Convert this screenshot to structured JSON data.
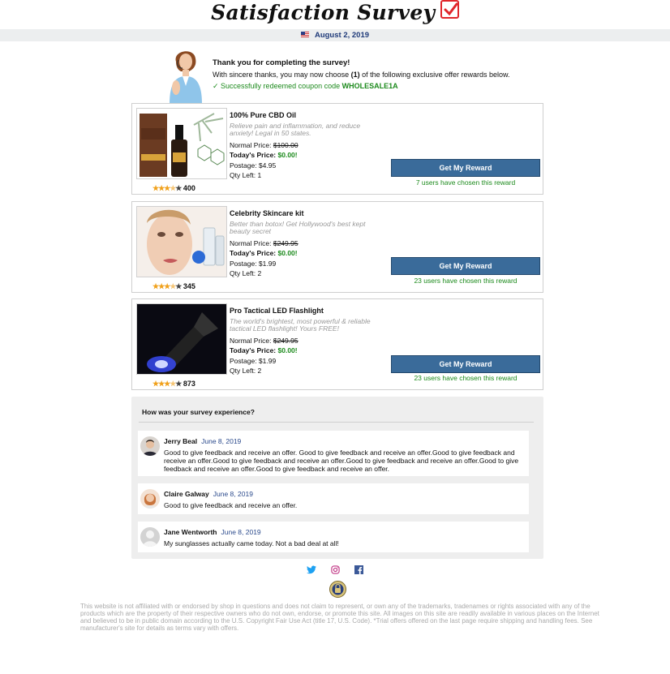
{
  "header": {
    "title": "Satisfaction Survey"
  },
  "datebar": {
    "date": "August 2, 2019"
  },
  "intro": {
    "heading": "Thank you for completing the survey!",
    "line2_pre": "With sincere thanks, you may now choose ",
    "line2_bold": "(1)",
    "line2_post": " of the following exclusive offer rewards below.",
    "coupon_pre": "✓ Successfully redeemed coupon code ",
    "coupon_code": "WHOLESALE1A"
  },
  "offers": [
    {
      "name": "100% Pure CBD Oil",
      "description": "Relieve pain and inflammation, and reduce anxiety! Legal in 50 states.",
      "normal_label": "Normal Price: ",
      "normal_price": "$100.00",
      "today_label": "Today's Price: ",
      "today_price": "$0.00!",
      "postage": "Postage: $4.95",
      "qty": "Qty Left: 1",
      "rating_count": "400",
      "rating": 3.5,
      "button": "Get My Reward",
      "chosen": "7 users have chosen this reward"
    },
    {
      "name": "Celebrity Skincare kit",
      "description": "Better than botox! Get Hollywood's best kept beauty secret",
      "normal_label": "Normal Price: ",
      "normal_price": "$249.95",
      "today_label": "Today's Price: ",
      "today_price": "$0.00!",
      "postage": "Postage: $1.99",
      "qty": "Qty Left: 2",
      "rating_count": "345",
      "rating": 3.5,
      "button": "Get My Reward",
      "chosen": "23 users have chosen this reward"
    },
    {
      "name": "Pro Tactical LED Flashlight",
      "description": "The world's brightest, most powerful & reliable tactical LED flashlight! Yours FREE!",
      "normal_label": "Normal Price: ",
      "normal_price": "$249.95",
      "today_label": "Today's Price: ",
      "today_price": "$0.00!",
      "postage": "Postage: $1.99",
      "qty": "Qty Left: 2",
      "rating_count": "873",
      "rating": 3.5,
      "button": "Get My Reward",
      "chosen": "23 users have chosen this reward"
    }
  ],
  "reviews": {
    "question": "How was your survey experience?",
    "items": [
      {
        "name": "Jerry Beal",
        "date": "June 8, 2019",
        "text": "Good to give feedback and receive an offer. Good to give feedback and receive an offer.Good to give feedback and receive an offer.Good to give feedback and receive an offer.Good to give feedback and receive an offer.Good to give feedback and receive an offer.Good to give feedback and receive an offer."
      },
      {
        "name": "Claire Galway",
        "date": "June 8, 2019",
        "text": "Good to give feedback and receive an offer."
      },
      {
        "name": "Jane Wentworth",
        "date": "June 8, 2019",
        "text": "My sunglasses actually came today. Not a bad deal at all!"
      }
    ]
  },
  "social": {
    "icons": [
      "twitter-icon",
      "instagram-icon",
      "facebook-icon"
    ]
  },
  "disclaimer": "This website is not affiliated with or endorsed by shop in questions and does not claim to represent, or own any of the trademarks, tradenames or rights associated with any of the products which are the property of their respective owners who do not own, endorse, or promote this site. All images on this site are readily available in various places on the Internet and believed to be in public domain according to the U.S. Copyright Fair Use Act (title 17, U.S. Code). *Trial offers offered on the last page require shipping and handling fees. See manufacturer's site for details as terms vary with offers.",
  "colors": {
    "accent_button": "#3a6b9a",
    "success": "#1c8a1c",
    "check_red": "#e0262b",
    "date_blue": "#1f3a79"
  }
}
